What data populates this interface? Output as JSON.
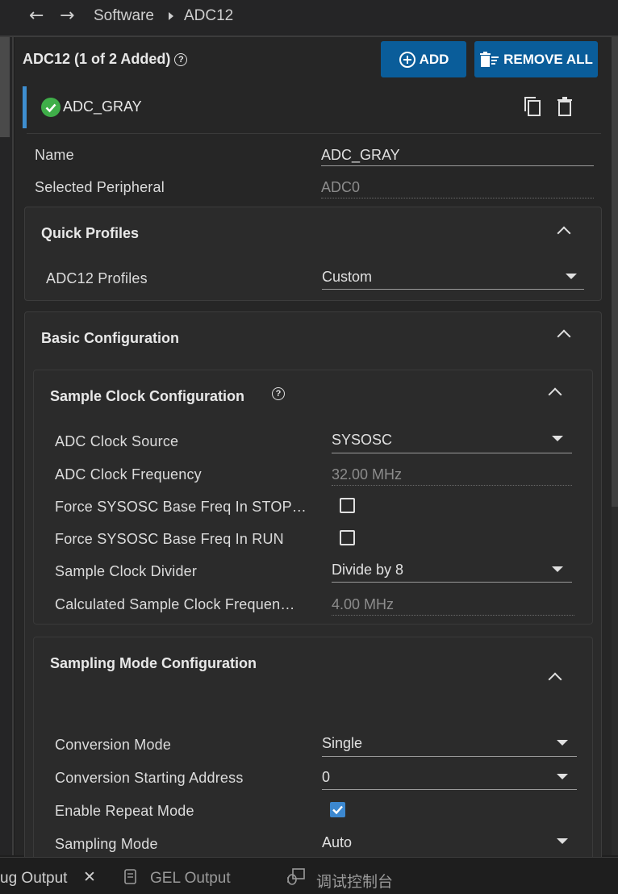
{
  "breadcrumb": {
    "root": "Software",
    "current": "ADC12"
  },
  "header": {
    "title": "ADC12 (1 of 2 Added)",
    "add_label": "ADD",
    "remove_all_label": "REMOVE ALL"
  },
  "instance": {
    "name": "ADC_GRAY"
  },
  "fields": {
    "name_label": "Name",
    "name_value": "ADC_GRAY",
    "peripheral_label": "Selected Peripheral",
    "peripheral_value": "ADC0"
  },
  "quick_profiles": {
    "title": "Quick Profiles",
    "profiles_label": "ADC12 Profiles",
    "profiles_value": "Custom"
  },
  "basic": {
    "title": "Basic Configuration"
  },
  "sample_clock": {
    "title": "Sample Clock Configuration",
    "source_label": "ADC Clock Source",
    "source_value": "SYSOSC",
    "freq_label": "ADC Clock Frequency",
    "freq_value": "32.00 MHz",
    "stop_label": "Force SYSOSC Base Freq In STOP…",
    "stop_checked": false,
    "run_label": "Force SYSOSC Base Freq In RUN",
    "run_checked": false,
    "divider_label": "Sample Clock Divider",
    "divider_value": "Divide by 8",
    "calc_label": "Calculated Sample Clock Frequen…",
    "calc_value": "4.00 MHz"
  },
  "sampling_mode": {
    "title": "Sampling Mode Configuration",
    "conv_mode_label": "Conversion Mode",
    "conv_mode_value": "Single",
    "start_addr_label": "Conversion Starting Address",
    "start_addr_value": "0",
    "repeat_label": "Enable Repeat Mode",
    "repeat_checked": true,
    "sampling_label": "Sampling Mode",
    "sampling_value": "Auto"
  },
  "bottom_tabs": {
    "debug": "ug Output",
    "gel": "GEL Output",
    "console": "调试控制台"
  },
  "colors": {
    "accent": "#3e8ed0",
    "button": "#0a5d9a",
    "success": "#3fae49"
  }
}
